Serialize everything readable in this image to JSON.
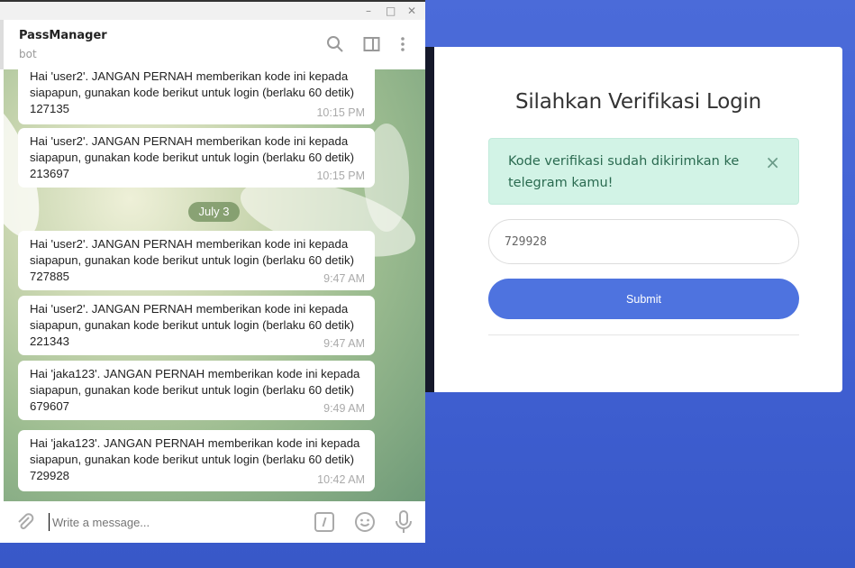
{
  "telegram": {
    "window_controls": {
      "minimize": "–",
      "maximize": "□",
      "close": "✕"
    },
    "chat_name": "PassManager",
    "chat_subtitle": "bot",
    "date_separator": "July 3",
    "messages": [
      {
        "text": "Hai 'user2'. JANGAN PERNAH memberikan kode ini kepada siapapun, gunakan kode berikut untuk login (berlaku 60 detik) 127135",
        "time": "10:15 PM"
      },
      {
        "text": "Hai 'user2'. JANGAN PERNAH memberikan kode ini kepada siapapun, gunakan kode berikut untuk login (berlaku 60 detik) 213697",
        "time": "10:15 PM"
      },
      {
        "text": "Hai 'user2'. JANGAN PERNAH memberikan kode ini kepada siapapun, gunakan kode berikut untuk login (berlaku 60 detik) 727885",
        "time": "9:47 AM"
      },
      {
        "text": "Hai 'user2'. JANGAN PERNAH memberikan kode ini kepada siapapun, gunakan kode berikut untuk login (berlaku 60 detik) 221343",
        "time": "9:47 AM"
      },
      {
        "text": "Hai 'jaka123'. JANGAN PERNAH memberikan kode ini kepada siapapun, gunakan kode berikut untuk login (berlaku 60 detik) 679607",
        "time": "9:49 AM"
      },
      {
        "text": "Hai 'jaka123'. JANGAN PERNAH memberikan kode ini kepada siapapun, gunakan kode berikut untuk login (berlaku 60 detik) 729928",
        "time": "10:42 AM"
      }
    ],
    "input_placeholder": "Write a message..."
  },
  "verify": {
    "title": "Silahkan Verifikasi Login",
    "alert_text": "Kode verifikasi sudah dikirimkan ke telegram kamu!",
    "alert_close": "×",
    "code_value": "729928",
    "submit_label": "Submit",
    "accent_color": "#4e73df",
    "alert_color": "#d2f3e6"
  }
}
